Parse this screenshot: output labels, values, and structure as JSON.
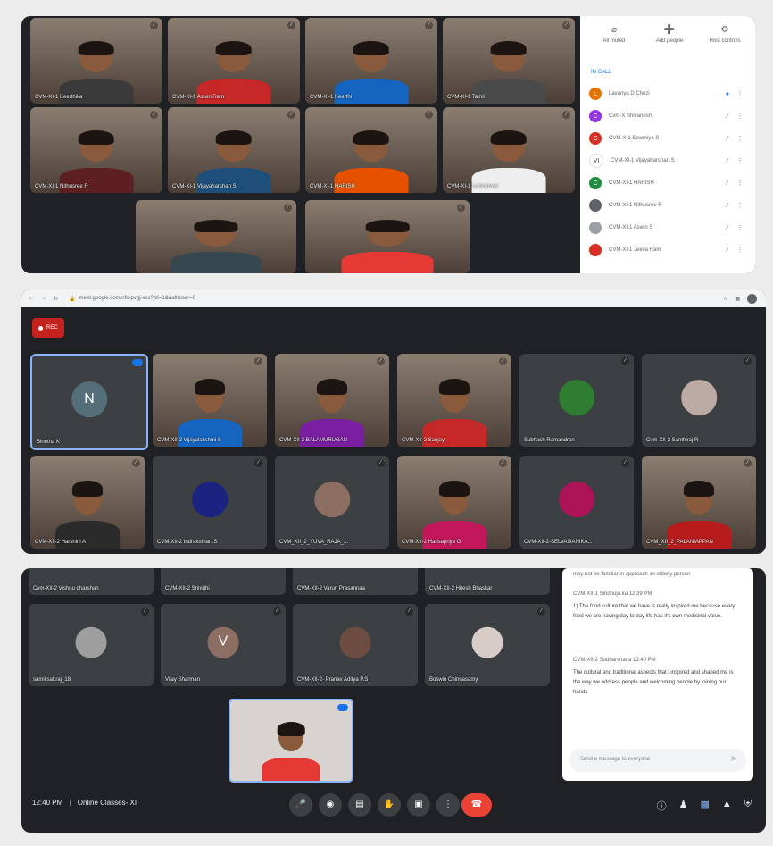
{
  "meeting_top": {
    "tiles": [
      {
        "name": "CVM-XI-1 Keerthika",
        "type": "video",
        "shirt": "#3a3a3a"
      },
      {
        "name": "CVM-XI-1 Aswin Ram",
        "type": "video",
        "shirt": "#c62828"
      },
      {
        "name": "CVM-XI-1 Keerthi",
        "type": "video",
        "shirt": "#1565c0"
      },
      {
        "name": "CVM-XI-1 Tamil",
        "type": "video",
        "shirt": "#4a4a4a"
      },
      {
        "name": "CVM-XI-1 Nithusree R",
        "type": "video",
        "shirt": "#5d1f1f"
      },
      {
        "name": "CVM-XI-1 Vijayaharshan S",
        "type": "video",
        "shirt": "#1e4f7a"
      },
      {
        "name": "CVM-XI-1 HARISH",
        "type": "video",
        "shirt": "#e65100"
      },
      {
        "name": "CVM-XI-1 Lokeshwar",
        "type": "video",
        "shirt": "#eeeeee"
      },
      {
        "name": "",
        "type": "video",
        "shirt": "#37474f"
      },
      {
        "name": "",
        "type": "video",
        "shirt": "#e53935"
      }
    ]
  },
  "people_panel": {
    "actions": [
      "All muted",
      "Add people",
      "Host controls"
    ],
    "section": "IN CALL",
    "people": [
      {
        "name": "Lavanya D Chezi",
        "initial": "L",
        "color": "#e37400"
      },
      {
        "name": "Cvm-X Shivanesh",
        "initial": "C",
        "color": "#9334e6"
      },
      {
        "name": "CVM-X-1 Sowmiya S",
        "initial": "C",
        "color": "#d93025"
      },
      {
        "name": "CVM-XI-1 Vijayaharshan.S",
        "initial": "VI",
        "color": "#ffffff"
      },
      {
        "name": "CVM-XI-1 HARISH",
        "initial": "C",
        "color": "#1e8e3e"
      },
      {
        "name": "CVM-XI-1 Nithusree R",
        "initial": "",
        "color": "#5f6368"
      },
      {
        "name": "CVM-XI-1 Aswin S",
        "initial": "",
        "color": "#9aa0a6"
      },
      {
        "name": "CVM-XI-1 Jeeva Ram",
        "initial": "",
        "color": "#d93025"
      }
    ]
  },
  "meeting_middle": {
    "url": "meet.google.com/nfo-pvgj-xxx?pli=1&authuser=0",
    "rec_label": "REC",
    "row1": [
      {
        "name": "Binetha K",
        "type": "avatar",
        "initial": "N",
        "avatar_color": "#546e7a",
        "active": true
      },
      {
        "name": "CVM-XII-2 Vijayalakshmi S",
        "type": "video",
        "shirt": "#1565c0"
      },
      {
        "name": "CVM-XII-2 BALAMURUGAN",
        "type": "video",
        "shirt": "#7b1fa2"
      },
      {
        "name": "CVM-XII-2 Sanjay",
        "type": "video",
        "shirt": "#c62828"
      },
      {
        "name": "Subhash Ramandran",
        "type": "avatar",
        "initial": "",
        "avatar_color": "#2e7d32"
      },
      {
        "name": "Cvm-XII-2 Santhiraj R",
        "type": "avatar",
        "initial": "",
        "avatar_color": "#bcaaa4"
      }
    ],
    "row2": [
      {
        "name": "CVM-XII-2 Harshini A",
        "type": "video",
        "shirt": "#2b2b2b"
      },
      {
        "name": "CVM-XII-2 Indrakumar .S",
        "type": "avatar",
        "initial": "",
        "avatar_color": "#1a237e"
      },
      {
        "name": "CVM_XII_2_YUVA_RAJA_...",
        "type": "avatar",
        "initial": "",
        "avatar_color": "#8d6e63"
      },
      {
        "name": "CVM-XII-2 Harisapriya G",
        "type": "video",
        "shirt": "#c2185b"
      },
      {
        "name": "CVM-XII-2-SELVAMANIKA...",
        "type": "avatar",
        "initial": "",
        "avatar_color": "#ad1457"
      },
      {
        "name": "CVM_XII_2_PALANIAPPAN",
        "type": "video",
        "shirt": "#b71c1c"
      }
    ]
  },
  "meeting_bottom": {
    "top_row": [
      "Cvm-XII-2 Vishnu dharshan",
      "CVM-XII-2 Srinidhi",
      "CVM-XII-2 Varun Prasannaa",
      "CVM-XII-2 Hitesh Bhaskar"
    ],
    "row": [
      {
        "name": "samiksat.raj_18",
        "type": "avatar",
        "initial": "",
        "avatar_color": "#9e9e9e"
      },
      {
        "name": "Vijay Sharman",
        "type": "avatar",
        "initial": "V",
        "avatar_color": "#8d6e63"
      },
      {
        "name": "CVM-XII-2- Pranav Aditya P.S",
        "type": "avatar",
        "initial": "",
        "avatar_color": "#6d4c41"
      },
      {
        "name": "Boswin Chinnasamy",
        "type": "avatar",
        "initial": "",
        "avatar_color": "#d7ccc8"
      }
    ],
    "self_tile": {
      "name": "",
      "shirt": "#e53935"
    },
    "clock": "12:40 PM",
    "meeting_title": "Online Classes- XI",
    "chat": {
      "intro": "may not be familiar in approach an elderly person",
      "messages": [
        {
          "meta": "CVM-XII-1 Sindhuja.ka 12:39 PM",
          "text": "1) The food culture that we have is really inspired me because every food we are having day to day life has it's own medicinal value."
        },
        {
          "meta": "CVM-XII-2 Sudharshana 12:40 PM",
          "text": "The cultural and traditional aspects that i inspired and shaped me is the way we address people and welcoming people by joining our hands"
        }
      ],
      "placeholder": "Send a message to everyone"
    }
  }
}
